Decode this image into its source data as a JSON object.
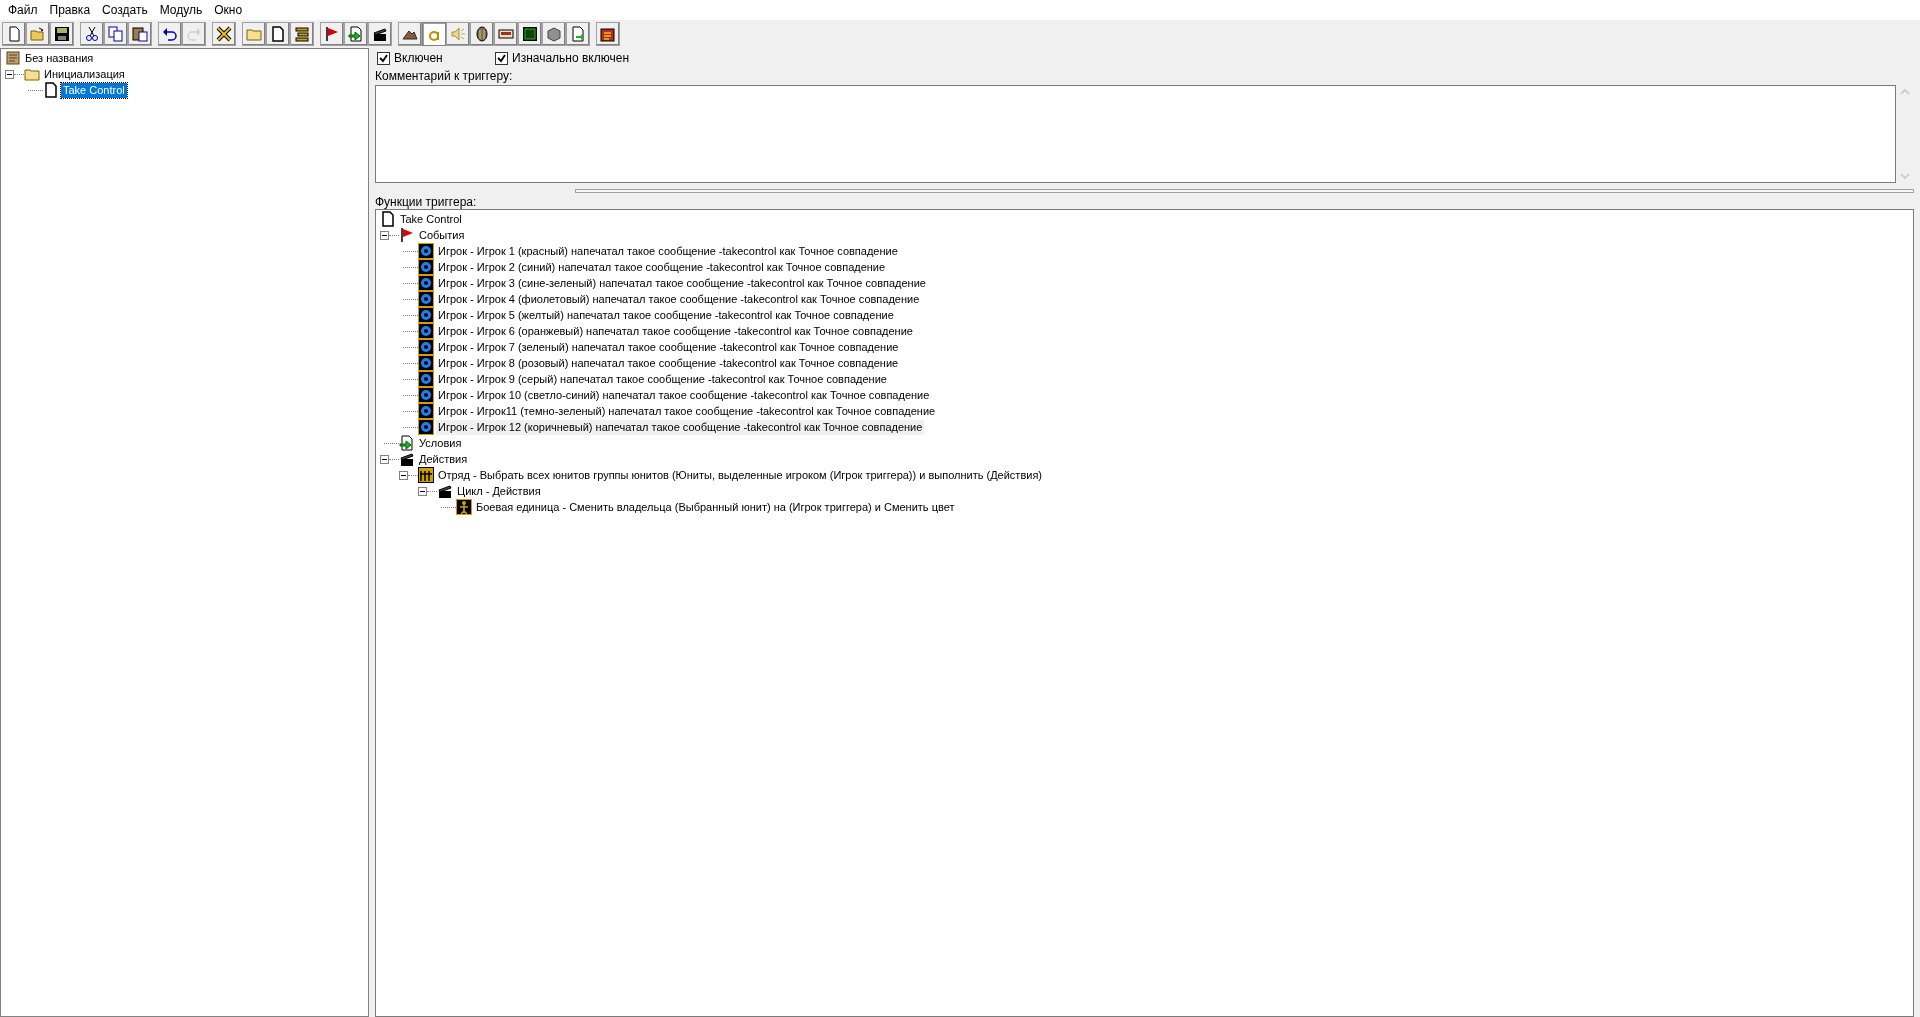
{
  "menu": [
    "Файл",
    "Правка",
    "Создать",
    "Модуль",
    "Окно"
  ],
  "toolbar": [
    [
      {
        "selected": false,
        "disabled": false
      },
      {
        "selected": false,
        "disabled": false
      },
      {
        "selected": false,
        "disabled": false
      }
    ],
    [
      {
        "selected": false,
        "disabled": false
      },
      {
        "selected": false,
        "disabled": false
      },
      {
        "selected": false,
        "disabled": false
      }
    ],
    [
      {
        "selected": false,
        "disabled": false
      },
      {
        "selected": false,
        "disabled": true
      }
    ],
    [
      {
        "selected": false,
        "disabled": false
      }
    ],
    [
      {
        "selected": false,
        "disabled": false
      },
      {
        "selected": false,
        "disabled": false
      },
      {
        "selected": false,
        "disabled": false
      }
    ],
    [
      {
        "selected": false,
        "disabled": false
      },
      {
        "selected": false,
        "disabled": false
      },
      {
        "selected": false,
        "disabled": false
      }
    ],
    [
      {
        "selected": false,
        "disabled": false
      },
      {
        "selected": true,
        "disabled": false
      },
      {
        "selected": false,
        "disabled": false
      },
      {
        "selected": false,
        "disabled": false
      },
      {
        "selected": false,
        "disabled": false
      },
      {
        "selected": false,
        "disabled": false
      },
      {
        "selected": false,
        "disabled": false
      },
      {
        "selected": false,
        "disabled": false
      }
    ],
    [
      {
        "selected": false,
        "disabled": false
      }
    ]
  ],
  "trigger_tree": [
    {
      "label": "Без названия",
      "kind": "map",
      "selected": false,
      "children": [
        {
          "label": "Инициализация",
          "kind": "folder",
          "selected": false,
          "expanded": true,
          "children": [
            {
              "label": "Take Control",
              "kind": "trigger",
              "selected": true
            }
          ]
        }
      ]
    }
  ],
  "enabled": {
    "label": "Включен",
    "checked": true
  },
  "initially_on": {
    "label": "Изначально включен",
    "checked": true
  },
  "comment": {
    "label": "Комментарий к триггеру:"
  },
  "functions_label": "Функции триггера:",
  "functions_tree": [
    {
      "label": "Take Control",
      "kind": "trigger",
      "selected": false,
      "children": [
        {
          "label": "События",
          "kind": "events",
          "selected": false,
          "expanded": true,
          "children": [
            {
              "label": "Игрок - Игрок 1 (красный) напечатал такое сообщение -takecontrol как Точное совпадение",
              "kind": "event",
              "selected": false
            },
            {
              "label": "Игрок - Игрок 2 (синий) напечатал такое сообщение -takecontrol как Точное совпадение",
              "kind": "event",
              "selected": false
            },
            {
              "label": "Игрок - Игрок 3 (сине-зеленый) напечатал такое сообщение -takecontrol как Точное совпадение",
              "kind": "event",
              "selected": false
            },
            {
              "label": "Игрок - Игрок 4 (фиолетовый) напечатал такое сообщение -takecontrol как Точное совпадение",
              "kind": "event",
              "selected": false
            },
            {
              "label": "Игрок - Игрок 5 (желтый) напечатал такое сообщение -takecontrol как Точное совпадение",
              "kind": "event",
              "selected": false
            },
            {
              "label": "Игрок - Игрок 6 (оранжевый) напечатал такое сообщение -takecontrol как Точное совпадение",
              "kind": "event",
              "selected": false
            },
            {
              "label": "Игрок - Игрок 7 (зеленый) напечатал такое сообщение -takecontrol как Точное совпадение",
              "kind": "event",
              "selected": false
            },
            {
              "label": "Игрок - Игрок 8 (розовый) напечатал такое сообщение -takecontrol как Точное совпадение",
              "kind": "event",
              "selected": false
            },
            {
              "label": "Игрок - Игрок 9 (серый) напечатал такое сообщение -takecontrol как Точное совпадение",
              "kind": "event",
              "selected": false
            },
            {
              "label": "Игрок - Игрок 10 (светло-синий) напечатал такое сообщение -takecontrol как Точное совпадение",
              "kind": "event",
              "selected": false
            },
            {
              "label": "Игрок - Игрок11 (темно-зеленый) напечатал такое сообщение -takecontrol как Точное совпадение",
              "kind": "event",
              "selected": false
            },
            {
              "label": "Игрок - Игрок 12 (коричневый) напечатал такое сообщение -takecontrol как Точное совпадение",
              "kind": "event",
              "selected": true
            }
          ]
        },
        {
          "label": "Условия",
          "kind": "conditions",
          "selected": false
        },
        {
          "label": "Действия",
          "kind": "actions",
          "selected": false,
          "expanded": true,
          "children": [
            {
              "label": "Отряд - Выбрать всех юнитов группы юнитов (Юниты, выделенные игроком (Игрок триггера)) и выполнить (Действия)",
              "kind": "group",
              "selected": false,
              "expanded": true,
              "children": [
                {
                  "label": "Цикл - Действия",
                  "kind": "actions",
                  "selected": false,
                  "expanded": true,
                  "children": [
                    {
                      "label": "Боевая единица - Сменить владельца (Выбранный юнит) на (Игрок триггера) и Сменить цвет",
                      "kind": "unit",
                      "selected": false
                    }
                  ]
                }
              ]
            }
          ]
        }
      ]
    }
  ]
}
